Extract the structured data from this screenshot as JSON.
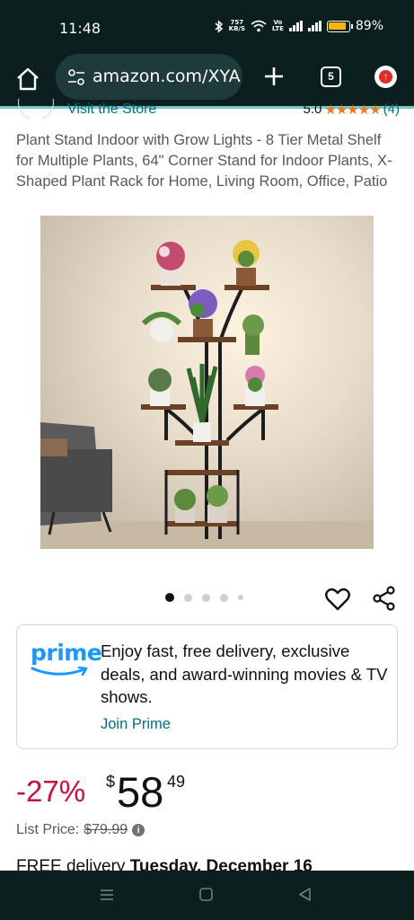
{
  "status_bar": {
    "time": "11:48",
    "net_speed_value": "757",
    "net_speed_unit": "KB/S",
    "volte_1": "Vo",
    "volte_2": "LTE",
    "battery_percent": "89%",
    "battery_level": 0.89,
    "battery_color": "#f0b90b"
  },
  "browser": {
    "url": "amazon.com/XYA",
    "tab_count": "5",
    "icons": [
      "home-icon",
      "site-settings-icon",
      "plus-icon",
      "tabs-icon",
      "update-icon"
    ]
  },
  "store": {
    "link_text": "Visit the Store",
    "rating_value": "5.0",
    "stars": "★★★★★",
    "rating_count": "(4)"
  },
  "product": {
    "title": "Plant Stand Indoor with Grow Lights - 8 Tier Metal Shelf for Multiple Plants, 64\" Corner Stand for Indoor Plants, X-Shaped Plant Rack for Home, Living Room, Office, Patio",
    "image_count": 5,
    "active_image": 1
  },
  "prime": {
    "logo_text": "prime",
    "message": "Enjoy fast, free delivery, exclusive deals, and award-winning movies & TV shows.",
    "join_label": "Join Prime"
  },
  "price": {
    "discount": "-27%",
    "currency": "$",
    "whole": "58",
    "fraction": "49",
    "list_price_label": "List Price:",
    "list_price_value": "$79.99"
  },
  "delivery": {
    "prefix": "FREE delivery ",
    "date": "Tuesday, December 16"
  },
  "colors": {
    "accent_link": "#007185",
    "discount_red": "#cc0c39",
    "star_orange": "#f0761f",
    "prime_blue": "#1a98ff",
    "chrome_bg": "#0b1f1f"
  }
}
